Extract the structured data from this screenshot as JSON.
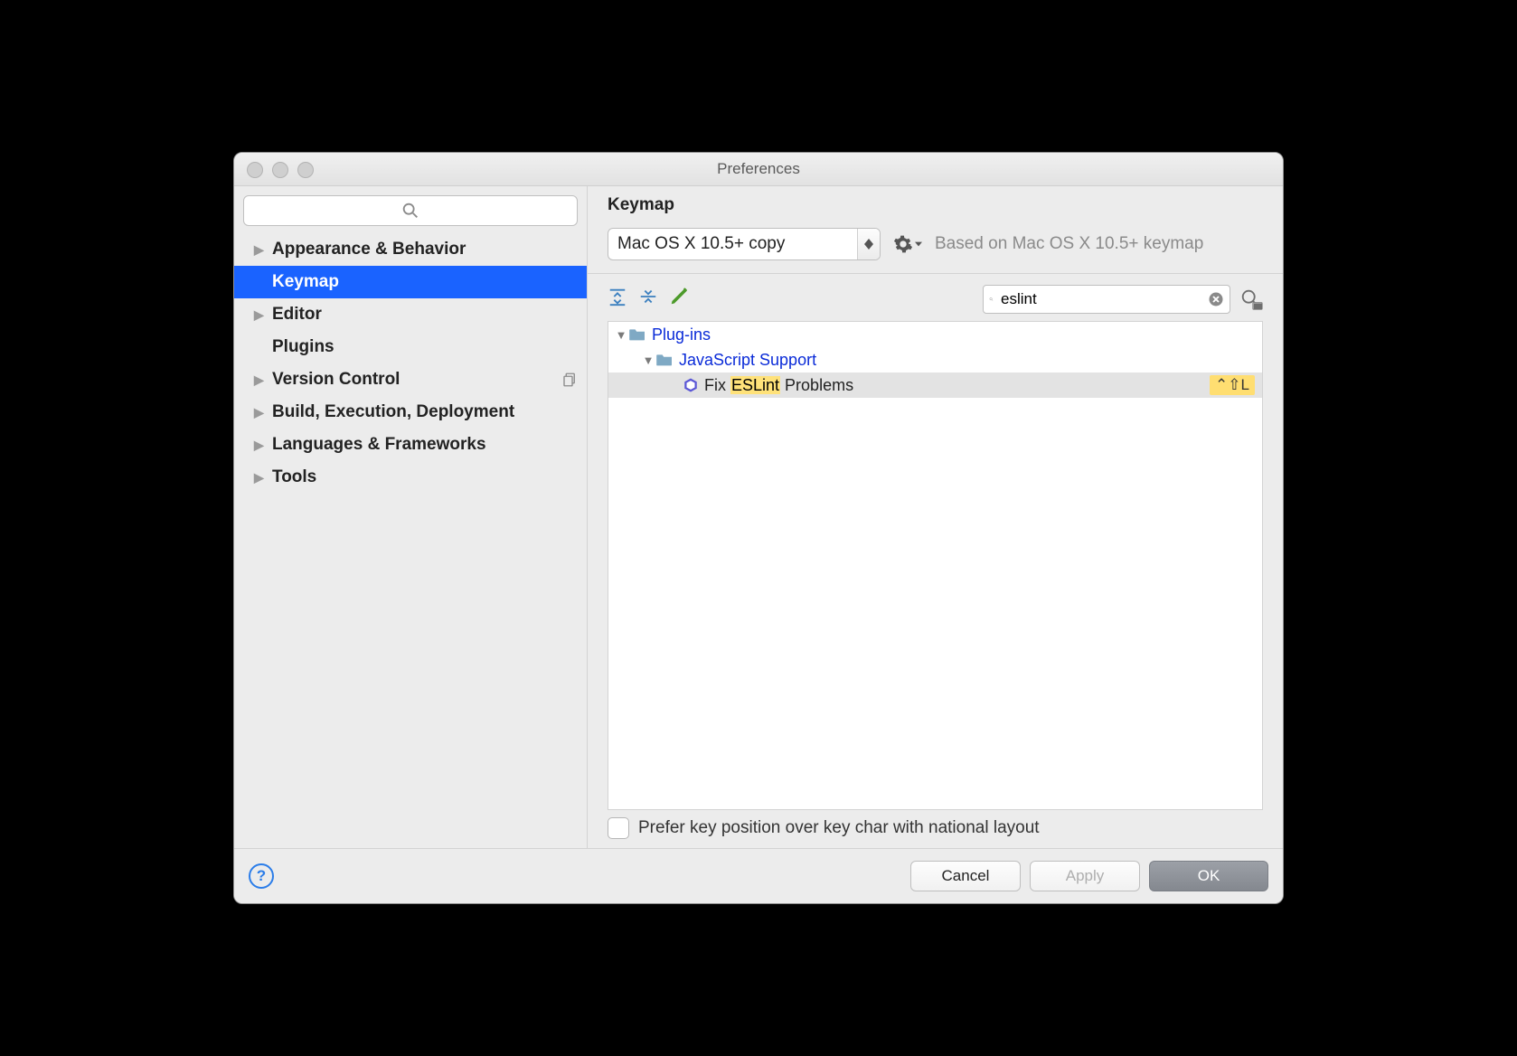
{
  "title": "Preferences",
  "sidebar": {
    "search_placeholder": "",
    "items": [
      {
        "label": "Appearance & Behavior",
        "arrow": true
      },
      {
        "label": "Keymap",
        "arrow": false,
        "selected": true
      },
      {
        "label": "Editor",
        "arrow": true
      },
      {
        "label": "Plugins",
        "arrow": false
      },
      {
        "label": "Version Control",
        "arrow": true,
        "copy_icon": true
      },
      {
        "label": "Build, Execution, Deployment",
        "arrow": true
      },
      {
        "label": "Languages & Frameworks",
        "arrow": true
      },
      {
        "label": "Tools",
        "arrow": true
      }
    ]
  },
  "main": {
    "header": "Keymap",
    "scheme": "Mac OS X 10.5+ copy",
    "based_on": "Based on Mac OS X 10.5+ keymap",
    "filter_value": "eslint",
    "tree": {
      "plugins_label": "Plug-ins",
      "js_label": "JavaScript Support",
      "action_pre": "Fix ",
      "action_hl": "ESLint",
      "action_post": " Problems",
      "shortcut": "⌃⇧L"
    },
    "option_label": "Prefer key position over key char with national layout",
    "option_checked": false
  },
  "footer": {
    "cancel": "Cancel",
    "apply": "Apply",
    "ok": "OK",
    "help": "?"
  }
}
